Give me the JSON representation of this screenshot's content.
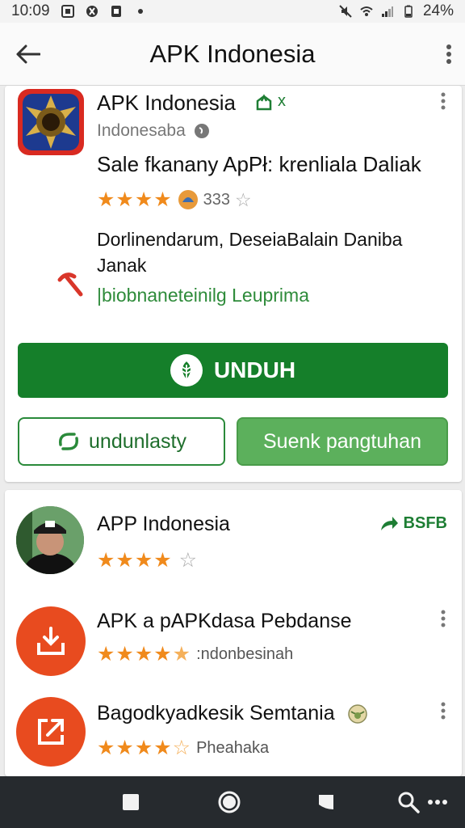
{
  "status_bar": {
    "time": "10:09",
    "battery": "24%"
  },
  "app_bar": {
    "title": "APK Indonesia"
  },
  "featured": {
    "name": "APK Indonesia",
    "verified_mark": "x",
    "developer": "Indonesaba",
    "tagline": "Sale fkanany ApPł: krenliala Daliak",
    "stars_filled": 4,
    "stars_total": 5,
    "rating_count": "333",
    "description": "Dorlinendarum, DeseiaBalain Daniba Janak",
    "link_text": "|biobnaneteinilg Leuprima",
    "primary_button": "UNDUH",
    "secondary_button": "undunlasty",
    "tertiary_button": "Suenk pangtuhan"
  },
  "list": [
    {
      "title": "APP Indonesia",
      "badge": "BSFB",
      "stars_filled": 4,
      "stars_total": 5,
      "sub": ""
    },
    {
      "title": "APK a pAPKdasa Pebdanse",
      "badge": "",
      "stars_filled": 4.5,
      "stars_total": 5,
      "sub": ":ndonbesinah"
    },
    {
      "title": "Bagodkyadkesik Semtania",
      "badge": "",
      "stars_filled": 4.5,
      "stars_total": 5,
      "sub": "Pheahaka"
    }
  ],
  "colors": {
    "primary_green": "#157f2a",
    "light_green": "#5cb05c",
    "star_orange": "#f08a1c",
    "icon_orange": "#e84b1f",
    "nav_bar": "#262a2e"
  },
  "icons": {
    "back": "arrow-left-icon",
    "more": "more-vert-icon",
    "verified": "verified-icon",
    "download": "download-icon",
    "share": "share-icon",
    "nav_recent": "square-icon",
    "nav_home": "circle-icon",
    "nav_back": "back-shape-icon",
    "nav_search": "search-icon",
    "nav_more": "more-horiz-icon"
  }
}
